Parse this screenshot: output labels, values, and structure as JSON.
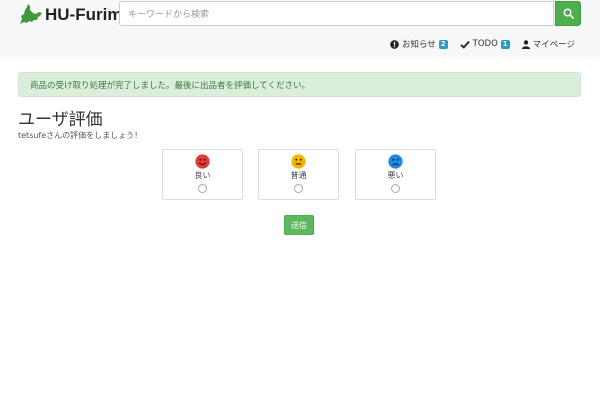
{
  "brand": {
    "name": "HU-Furima",
    "logo_color": "#3e9c3e"
  },
  "search": {
    "placeholder": "キーワードから検索",
    "value": "",
    "button_icon": "search-icon",
    "button_color": "#4cae4c"
  },
  "nav": {
    "notifications": {
      "label": "お知らせ",
      "count": "2",
      "icon": "exclamation-circle-icon"
    },
    "todo": {
      "label": "TODO",
      "count": "1",
      "icon": "check-icon"
    },
    "mypage": {
      "label": "マイページ",
      "icon": "user-icon"
    }
  },
  "alert": {
    "text": "商品の受け取り処理が完了しました。最後に出品者を評価してください。",
    "color": "#dbeedb"
  },
  "page": {
    "title": "ユーザ評価",
    "subtitle": "tetsufeさんの評価をしましょう！"
  },
  "ratings": [
    {
      "label": "良い",
      "icon": "smile-icon",
      "color": "#e53935",
      "selected": false
    },
    {
      "label": "普通",
      "icon": "neutral-face-icon",
      "color": "#f5b400",
      "selected": false
    },
    {
      "label": "悪い",
      "icon": "frown-icon",
      "color": "#1e88e5",
      "selected": false
    }
  ],
  "submit": {
    "label": "送信",
    "color": "#5cb85c"
  }
}
